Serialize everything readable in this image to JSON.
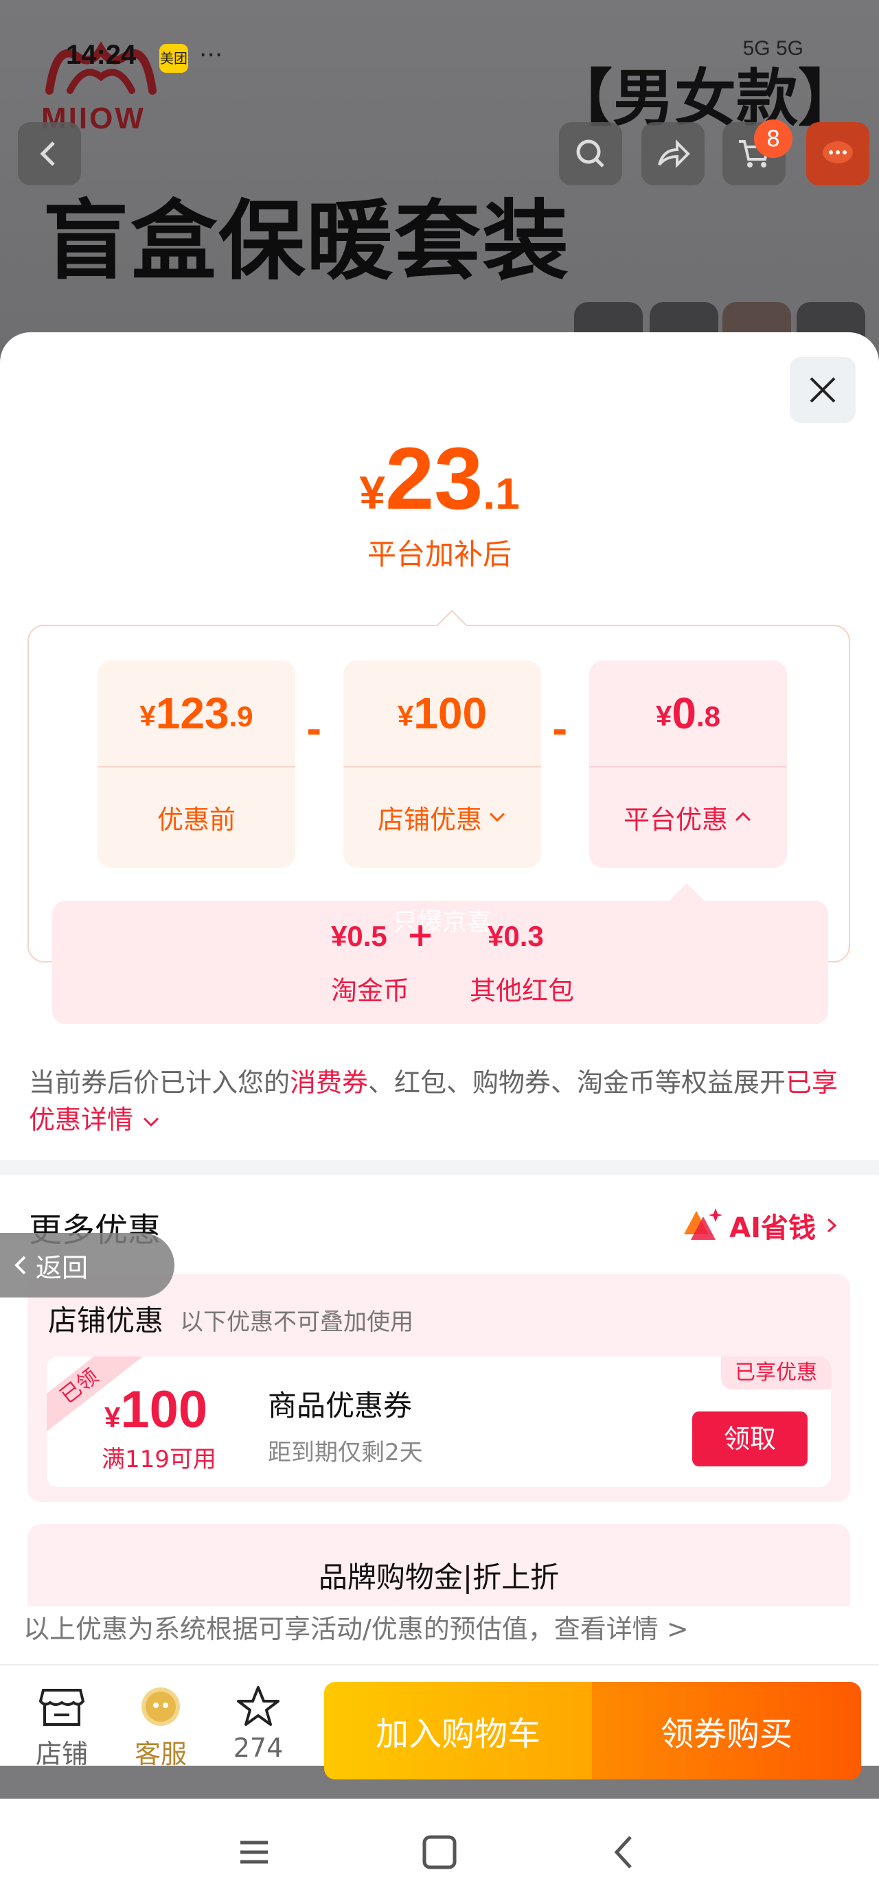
{
  "status_bar": {
    "time": "14:24",
    "app_badge": "美团",
    "more": "···",
    "network": "5G 5G"
  },
  "background": {
    "logo_text": "MIIOW",
    "promo_tag": "【男女款】",
    "promo_title": "盲盒保暖套装",
    "cart_count": "8"
  },
  "sheet": {
    "final_price": {
      "currency": "¥",
      "integer": "23",
      "decimal": ".1"
    },
    "final_label": "平台加补后",
    "breakdown": {
      "items": [
        {
          "currency": "¥",
          "integer": "123",
          "decimal": ".9",
          "label": "优惠前"
        },
        {
          "currency": "¥",
          "integer": "100",
          "decimal": "",
          "label": "店铺优惠"
        },
        {
          "currency": "¥",
          "integer": "0",
          "decimal": ".8",
          "label": "平台优惠"
        }
      ],
      "minus": "-",
      "sub": {
        "watermark": "只爆京喜",
        "plus": "+",
        "items": [
          {
            "value": "¥0.5",
            "label": "淘金币"
          },
          {
            "value": "¥0.3",
            "label": "其他红包"
          }
        ]
      }
    },
    "note": {
      "part1": "当前券后价已计入您的",
      "highlight1": "消费券",
      "part2": "、红包、购物券、淘金币等权益展开",
      "highlight2": "已享优惠详情"
    },
    "more": {
      "title": "更多优惠",
      "ai_label": "AI省钱",
      "back_label": "返回"
    },
    "shop_discount": {
      "title": "店铺优惠",
      "subtitle": "以下优惠不可叠加使用",
      "coupon": {
        "claimed": "已领",
        "currency": "¥",
        "amount": "100",
        "condition": "满119可用",
        "name": "商品优惠券",
        "expiry": "距到期仅剩2天",
        "enjoyed": "已享优惠",
        "claim_button": "领取"
      }
    },
    "brand": {
      "title": "品牌购物金|折上折"
    },
    "disclaimer": "以上优惠为系统根据可享活动/优惠的预估值，查看详情 >"
  },
  "bottom_bar": {
    "shop": "店铺",
    "service": "客服",
    "favorites": "274",
    "add_to_cart": "加入购物车",
    "buy": "领券购买"
  },
  "colors": {
    "accent_orange": "#ff5500",
    "accent_red": "#ef1b44",
    "cart_yellow": "#ffc800"
  }
}
